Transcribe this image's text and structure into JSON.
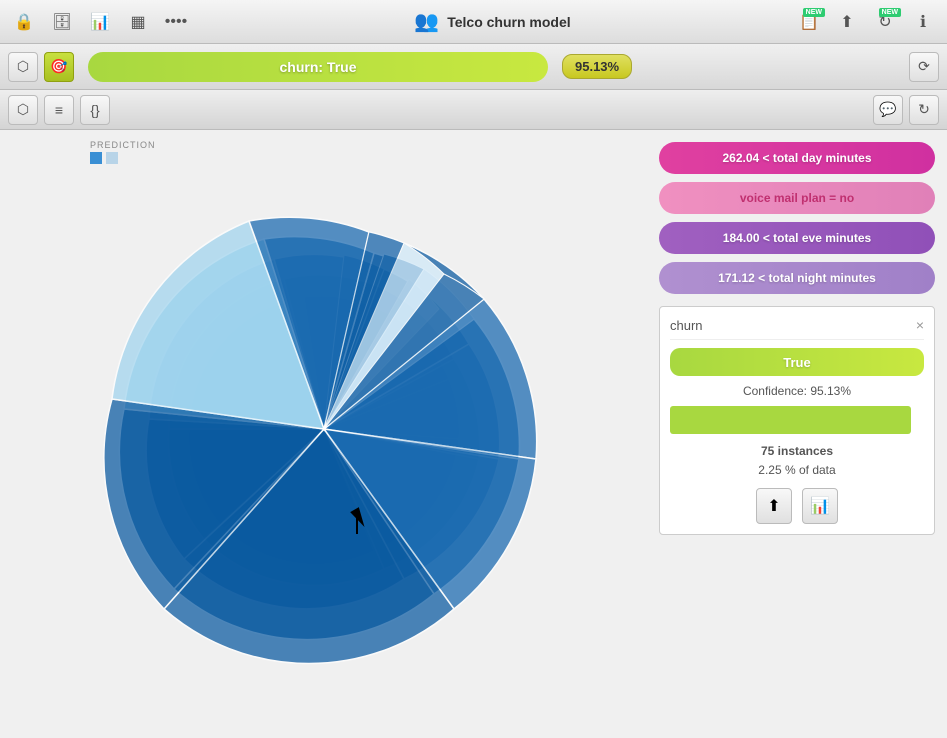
{
  "app": {
    "title": "Telco churn model",
    "window_icons": [
      "lock-icon",
      "database-icon",
      "chart-icon",
      "table-icon",
      "more-icon"
    ]
  },
  "toolbar": {
    "churn_label": "churn: True",
    "confidence": "95.13%",
    "view_icons": [
      "tree-icon",
      "target-icon"
    ]
  },
  "sub_toolbar": {
    "icons": [
      "graph-icon",
      "list-icon",
      "code-icon"
    ]
  },
  "prediction_legend": {
    "label": "PREDICTION",
    "box1_color": "#3a8fd4",
    "box2_color": "#b8d4e8"
  },
  "features": [
    {
      "id": "feature-1",
      "label": "262.04 < total day minutes",
      "color_class": "feature-bar-1"
    },
    {
      "id": "feature-2",
      "label": "voice mail plan = no",
      "color_class": "feature-bar-2"
    },
    {
      "id": "feature-3",
      "label": "184.00 < total eve minutes",
      "color_class": "feature-bar-3"
    },
    {
      "id": "feature-4",
      "label": "171.12 < total night minutes",
      "color_class": "feature-bar-4"
    }
  ],
  "info_card": {
    "title": "churn",
    "close_label": "×",
    "true_label": "True",
    "confidence_label": "Confidence: 95.13%",
    "instances_label": "75 instances",
    "data_pct_label": "2.25 % of data",
    "actions": [
      {
        "id": "download-btn",
        "icon": "⬆"
      },
      {
        "id": "chart-btn",
        "icon": "📊"
      }
    ]
  },
  "refresh_icon": "↻",
  "chat_icon": "💬",
  "arrow_icon": "⟳"
}
